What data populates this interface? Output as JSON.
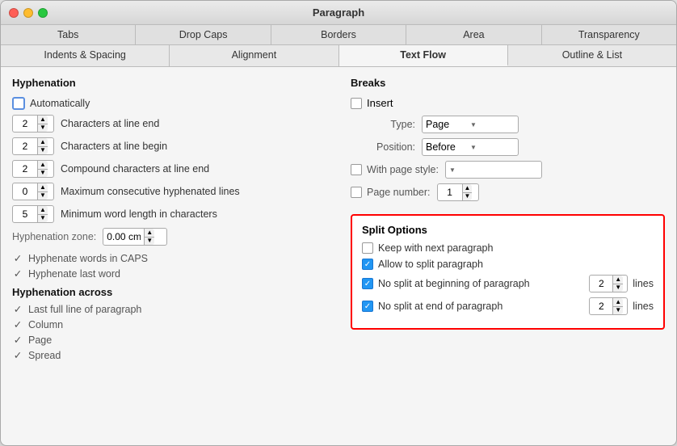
{
  "window": {
    "title": "Paragraph"
  },
  "tabs_row1": [
    {
      "id": "tabs",
      "label": "Tabs",
      "active": false
    },
    {
      "id": "drop-caps",
      "label": "Drop Caps",
      "active": false
    },
    {
      "id": "borders",
      "label": "Borders",
      "active": false
    },
    {
      "id": "area",
      "label": "Area",
      "active": false
    },
    {
      "id": "transparency",
      "label": "Transparency",
      "active": false
    }
  ],
  "tabs_row2": [
    {
      "id": "indents-spacing",
      "label": "Indents & Spacing",
      "active": false
    },
    {
      "id": "alignment",
      "label": "Alignment",
      "active": false
    },
    {
      "id": "text-flow",
      "label": "Text Flow",
      "active": true
    },
    {
      "id": "outline-list",
      "label": "Outline & List",
      "active": false
    }
  ],
  "hyphenation": {
    "title": "Hyphenation",
    "auto_label": "Automatically",
    "rows": [
      {
        "value": "2",
        "label": "Characters at line end"
      },
      {
        "value": "2",
        "label": "Characters at line begin"
      },
      {
        "value": "2",
        "label": "Compound characters at line end"
      },
      {
        "value": "0",
        "label": "Maximum consecutive hyphenated lines"
      },
      {
        "value": "5",
        "label": "Minimum word length in characters"
      }
    ],
    "zone_label": "Hyphenation zone:",
    "zone_value": "0.00 cm",
    "check_items": [
      "Hyphenate words in CAPS",
      "Hyphenate last word"
    ],
    "across_title": "Hyphenation across",
    "across_items": [
      "Last full line of paragraph",
      "Column",
      "Page",
      "Spread"
    ]
  },
  "breaks": {
    "title": "Breaks",
    "insert_label": "Insert",
    "type_label": "Type:",
    "type_value": "Page",
    "position_label": "Position:",
    "position_value": "Before",
    "page_style_label": "With page style:",
    "page_style_value": "",
    "page_number_label": "Page number:",
    "page_number_value": "1"
  },
  "split_options": {
    "title": "Split Options",
    "keep_next_label": "Keep with next paragraph",
    "allow_split_label": "Allow to split paragraph",
    "no_split_begin_label": "No split at beginning of paragraph",
    "no_split_begin_value": "2",
    "no_split_end_label": "No split at end of paragraph",
    "no_split_end_value": "2",
    "lines_label": "lines"
  }
}
